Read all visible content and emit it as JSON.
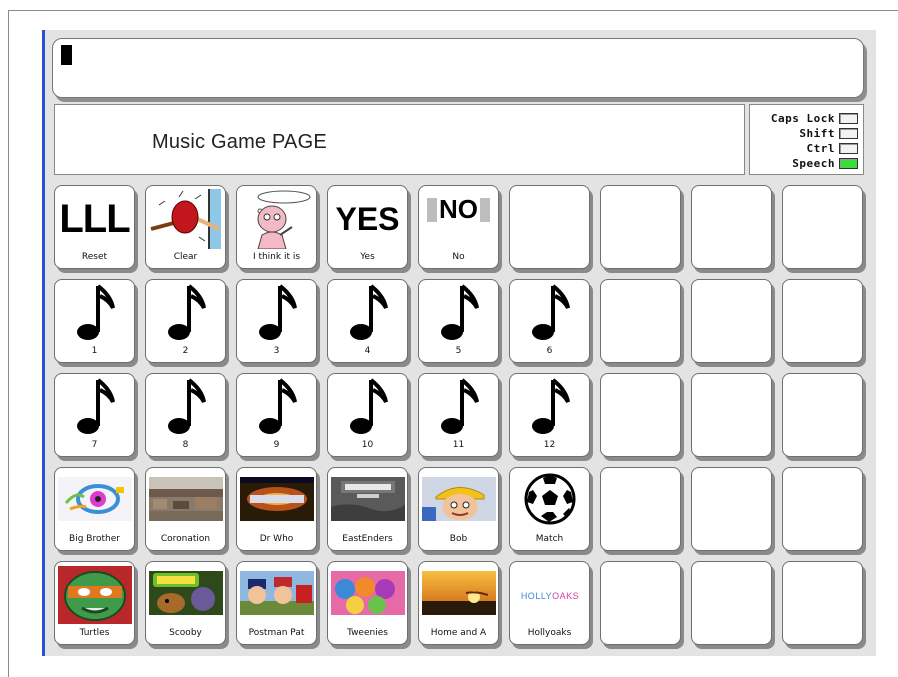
{
  "text_area": {
    "content": ""
  },
  "page_title": "Music Game PAGE",
  "status": [
    {
      "label": "Caps Lock",
      "on": false
    },
    {
      "label": "Shift",
      "on": false
    },
    {
      "label": "Ctrl",
      "on": false
    },
    {
      "label": "Speech",
      "on": true,
      "color": "#3ddc3d"
    }
  ],
  "rows": [
    [
      {
        "label": "Reset",
        "icon": "lll-icon",
        "text": "LLL"
      },
      {
        "label": "Clear",
        "icon": "clear-wipe-icon"
      },
      {
        "label": "I think it is",
        "icon": "thinking-person-icon"
      },
      {
        "label": "Yes",
        "icon": "yes-icon",
        "text": "YES"
      },
      {
        "label": "No",
        "icon": "no-icon",
        "text": "NO"
      },
      null,
      null,
      null,
      null
    ],
    [
      {
        "label": "1",
        "icon": "music-note-icon"
      },
      {
        "label": "2",
        "icon": "music-note-icon"
      },
      {
        "label": "3",
        "icon": "music-note-icon"
      },
      {
        "label": "4",
        "icon": "music-note-icon"
      },
      {
        "label": "5",
        "icon": "music-note-icon"
      },
      {
        "label": "6",
        "icon": "music-note-icon"
      },
      null,
      null,
      null
    ],
    [
      {
        "label": "7",
        "icon": "music-note-icon"
      },
      {
        "label": "8",
        "icon": "music-note-icon"
      },
      {
        "label": "9",
        "icon": "music-note-icon"
      },
      {
        "label": "10",
        "icon": "music-note-icon"
      },
      {
        "label": "11",
        "icon": "music-note-icon"
      },
      {
        "label": "12",
        "icon": "music-note-icon"
      },
      null,
      null,
      null
    ],
    [
      {
        "label": "Big Brother",
        "icon": "big-brother-logo-icon"
      },
      {
        "label": "Coronation",
        "icon": "coronation-street-photo-icon"
      },
      {
        "label": "Dr Who",
        "icon": "dr-who-logo-icon"
      },
      {
        "label": "EastEnders",
        "icon": "eastenders-logo-icon"
      },
      {
        "label": "Bob",
        "icon": "bob-the-builder-icon"
      },
      {
        "label": "Match",
        "icon": "football-icon"
      },
      null,
      null,
      null
    ],
    [
      {
        "label": "Turtles",
        "icon": "ninja-turtle-icon"
      },
      {
        "label": "Scooby",
        "icon": "scooby-doo-icon"
      },
      {
        "label": "Postman Pat",
        "icon": "postman-pat-icon"
      },
      {
        "label": "Tweenies",
        "icon": "tweenies-icon"
      },
      {
        "label": "Home and A",
        "icon": "home-and-away-icon"
      },
      {
        "label": "Hollyoaks",
        "icon": "hollyoaks-logo-icon",
        "text": "HOLLYOAKS"
      },
      null,
      null,
      null
    ]
  ]
}
